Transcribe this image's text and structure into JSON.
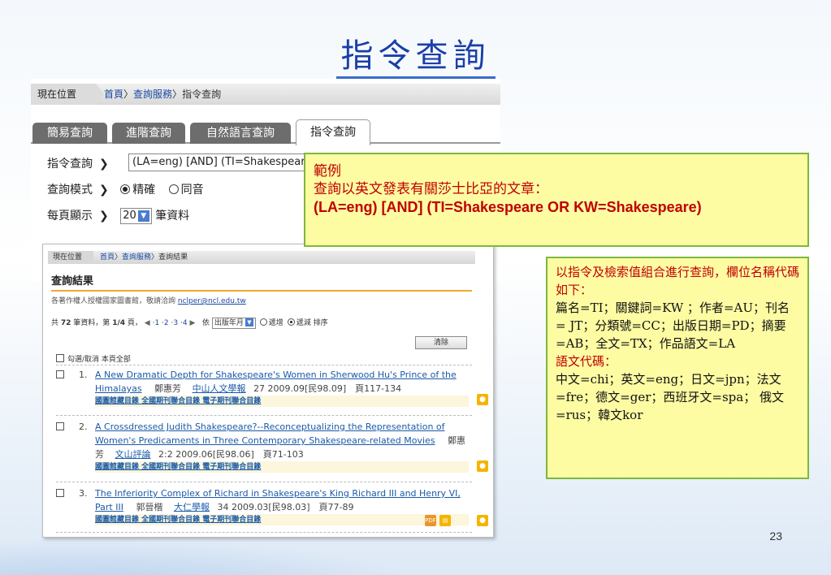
{
  "slide": {
    "title": "指令查詢",
    "page_number": "23"
  },
  "search_panel": {
    "breadcrumb": {
      "here": "現在位置",
      "home": "首頁",
      "section": "查詢服務",
      "current": "指令查詢",
      "sep": "〉"
    },
    "tabs": [
      {
        "label": "簡易查詢"
      },
      {
        "label": "進階查詢"
      },
      {
        "label": "自然語言查詢"
      },
      {
        "label": "指令查詢"
      }
    ],
    "active_tab": "指令查詢",
    "command_label": "指令查詢",
    "command_value": "(LA=eng) [AND] (TI=Shakespeare OR KW=Shakespeare)",
    "mode_label": "查詢模式",
    "mode_exact": "精確",
    "mode_homophone": "同音",
    "per_page_label": "每頁顯示",
    "per_page_value": "20",
    "per_page_unit": "筆資料",
    "arrow": "❯"
  },
  "results_panel": {
    "breadcrumb": {
      "here": "現在位置",
      "home": "首頁",
      "section": "查詢服務",
      "current": "查詢結果",
      "sep": "〉"
    },
    "title": "查詢結果",
    "notice_text": "各著作權人授權國家圖書館，敬請洽詢",
    "notice_email": "nclper@ncl.edu.tw",
    "total_prefix": "共",
    "total_count": "72",
    "total_suffix": "筆資料，第",
    "page_info": "1/4",
    "page_suffix": "頁，",
    "pages": [
      "1",
      "2",
      "3",
      "4"
    ],
    "sort_by_label": "依",
    "sort_field": "出版年月",
    "sort_asc": "遞增",
    "sort_desc": "遞減",
    "sort_label": "排序",
    "clear_button": "清除",
    "select_all_label": "勾選/取消 本頁全部",
    "items": [
      {
        "num": "1.",
        "title": "A New Dramatic Depth for Shakespeare's Women in Sherwood Hu's Prince of the Himalayas",
        "author": "鄭惠芳",
        "journal": "中山人文學報",
        "meta": "27 2009.09[民98.09]　頁117-134",
        "links": "國圖館藏目錄 全國期刊聯合目錄 電子期刊聯合目錄"
      },
      {
        "num": "2.",
        "title": "A Crossdressed Judith Shakespeare?--Reconceptualizing the Representation of Women's Predicaments in Three Contemporary Shakespeare-related Movies",
        "author": "鄭惠芳",
        "journal": "文山評論",
        "meta": "2:2 2009.06[民98.06]　頁71-103",
        "links": "國圖館藏目錄 全國期刊聯合目錄 電子期刊聯合目錄"
      },
      {
        "num": "3.",
        "title": "The Inferiority Complex of Richard in Shakespeare's King Richard III and Henry VI, Part III",
        "author": "郭晉楷",
        "journal": "大仁學報",
        "meta": "34 2009.03[民98.03]　頁77-89",
        "links": "國圖館藏目錄 全國期刊聯合目錄 電子期刊聯合目錄"
      }
    ]
  },
  "callout_example": {
    "heading": "範例",
    "description": "查詢以英文發表有關莎士比亞的文章：",
    "query": "(LA=eng) [AND] (TI=Shakespeare OR KW=Shakespeare)"
  },
  "callout_codes": {
    "intro": "以指令及檢索值組合進行查詢，欄位名稱代碼如下：",
    "field_codes": "篇名=TI；關鍵詞=KW ；作者=AU；刊名= JT；分類號=CC；出版日期=PD；摘要=AB；全文=TX；作品語文=LA",
    "lang_heading": "語文代碼：",
    "lang_codes": "中文=chi；英文=eng；日文=jpn；法文=fre；德文=ger；西班牙文=spa； 俄文=rus；韓文kor"
  },
  "colors": {
    "title_blue": "#1a3fa8",
    "link_blue": "#1a5aa8",
    "callout_bg": "#fdfca3",
    "callout_border": "#7db83a",
    "emphasis_red": "#c00000",
    "tab_gray": "#6d6d6d"
  }
}
